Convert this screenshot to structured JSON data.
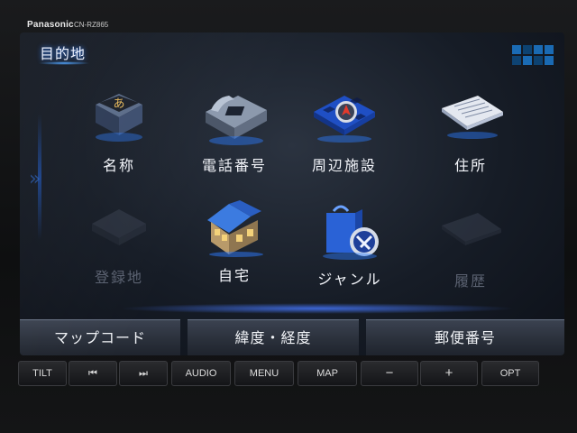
{
  "device": {
    "brand": "Panasonic",
    "model": "CN-RZ865"
  },
  "screen": {
    "title": "目的地"
  },
  "menu": {
    "items": [
      {
        "name": "name",
        "label": "名称",
        "icon": "hiragana-a-icon",
        "enabled": true
      },
      {
        "name": "phone",
        "label": "電話番号",
        "icon": "telephone-icon",
        "enabled": true
      },
      {
        "name": "nearby",
        "label": "周辺施設",
        "icon": "compass-map-icon",
        "enabled": true
      },
      {
        "name": "address",
        "label": "住所",
        "icon": "document-icon",
        "enabled": true
      },
      {
        "name": "registered",
        "label": "登録地",
        "icon": "registered-places-icon",
        "enabled": false
      },
      {
        "name": "home",
        "label": "自宅",
        "icon": "house-icon",
        "enabled": true
      },
      {
        "name": "genre",
        "label": "ジャンル",
        "icon": "shopping-bag-icon",
        "enabled": true
      },
      {
        "name": "history",
        "label": "履歴",
        "icon": "history-icon",
        "enabled": false
      }
    ]
  },
  "softkeys": {
    "mapcode": "マップコード",
    "latlon": "緯度・経度",
    "postal": "郵便番号"
  },
  "hardware": {
    "tilt": "TILT",
    "prev": "⏮",
    "next": "⏭",
    "audio": "AUDIO",
    "menu": "MENU",
    "map": "MAP",
    "minus": "−",
    "plus": "+",
    "opt": "OPT"
  },
  "colors": {
    "accent": "#2d7cff",
    "screen_bg": "#161c26"
  }
}
